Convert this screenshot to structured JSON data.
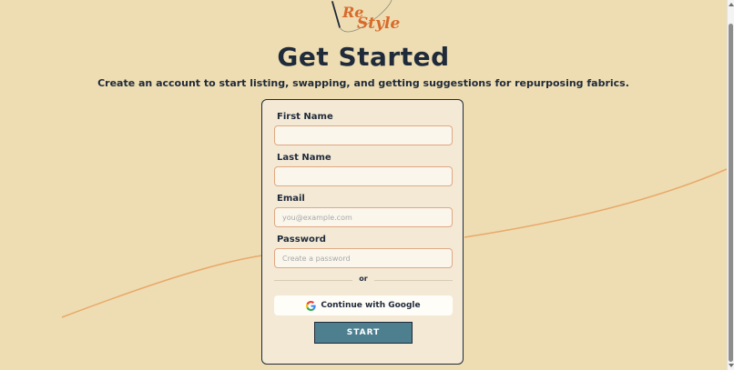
{
  "app": {
    "logo": {
      "line1": "Re",
      "line2": "Style"
    }
  },
  "header": {
    "title": "Get Started",
    "subtitle": "Create an account to start listing, swapping, and getting suggestions for repurposing fabrics."
  },
  "form": {
    "first_name": {
      "label": "First Name",
      "value": "",
      "placeholder": ""
    },
    "last_name": {
      "label": "Last Name",
      "value": "",
      "placeholder": ""
    },
    "email": {
      "label": "Email",
      "value": "",
      "placeholder": "you@example.com"
    },
    "password": {
      "label": "Password",
      "value": "",
      "placeholder": "Create a password"
    },
    "divider_text": "or",
    "google_button": "Continue with Google",
    "start_button": "START"
  },
  "colors": {
    "background": "#EEDDB2",
    "card": "#F4E9D5",
    "accent_orange": "#d86a2b",
    "thread": "#E8A86A",
    "input_border": "#e0a882",
    "start_button": "#4d7f8f",
    "text_dark": "#1f2a3a"
  },
  "icons": {
    "logo_needle": "needle-icon",
    "google": "google-icon"
  }
}
